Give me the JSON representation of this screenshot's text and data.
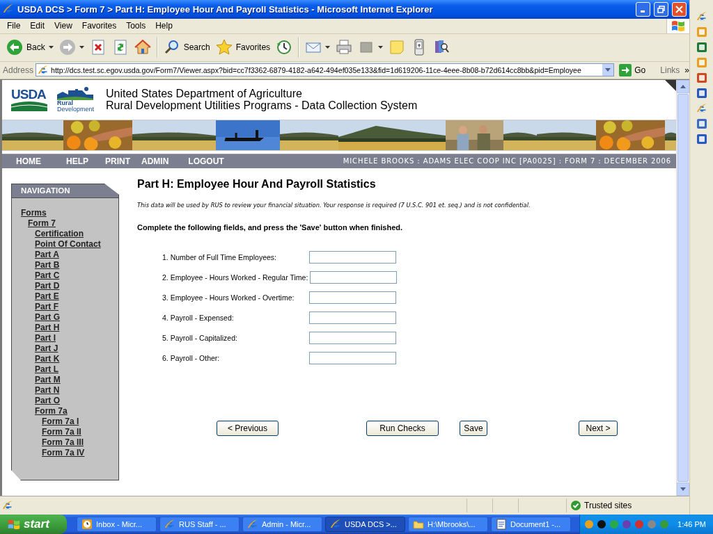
{
  "window": {
    "title": "USDA DCS > Form 7 > Part H: Employee Hour And Payroll Statistics - Microsoft Internet Explorer"
  },
  "menu_bar": [
    "File",
    "Edit",
    "View",
    "Favorites",
    "Tools",
    "Help"
  ],
  "toolbar": [
    {
      "kind": "back",
      "label": "Back",
      "dropdown": true
    },
    {
      "kind": "forward",
      "dropdown": true
    },
    {
      "kind": "stop",
      "dropdown": false
    },
    {
      "kind": "refresh",
      "dropdown": false
    },
    {
      "kind": "home",
      "dropdown": false
    },
    {
      "kind": "separator"
    },
    {
      "kind": "search",
      "label": "Search",
      "dropdown": false
    },
    {
      "kind": "favorites",
      "label": "Favorites",
      "dropdown": false
    },
    {
      "kind": "history",
      "dropdown": false
    },
    {
      "kind": "separator"
    },
    {
      "kind": "mail",
      "dropdown": true
    },
    {
      "kind": "print",
      "dropdown": false
    },
    {
      "kind": "edit",
      "dropdown": true
    },
    {
      "kind": "note",
      "dropdown": false
    },
    {
      "kind": "device",
      "dropdown": false
    },
    {
      "kind": "research",
      "dropdown": false
    }
  ],
  "address_bar": {
    "label": "Address",
    "url": "http://dcs.test.sc.egov.usda.gov/Form7/Viewer.aspx?bid=cc7f3362-6879-4182-a642-494ef035e133&fid=1d619206-11ce-4eee-8b08-b72d614cc8bb&pid=Employee",
    "go": "Go",
    "links": "Links",
    "links_more": "»"
  },
  "page": {
    "logo": {
      "usda": "USDA",
      "rd_line_1": "Rural",
      "rd_line_2": "Development"
    },
    "header_lines": [
      "United States Department of Agriculture",
      "Rural Development Utilities Programs - Data Collection System"
    ],
    "nav_links": [
      "HOME",
      "HELP",
      "PRINT",
      "ADMIN",
      "LOGOUT"
    ],
    "user_info": "MICHELE BROOKS : ADAMS ELEC COOP INC [PA0025] : FORM 7 : DECEMBER 2006",
    "navigation": {
      "title": "NAVIGATION",
      "items": [
        {
          "label": "Forms",
          "children": [
            {
              "label": "Form 7",
              "children": [
                {
                  "label": "Certification"
                },
                {
                  "label": "Point Of Contact"
                },
                {
                  "label": "Part A"
                },
                {
                  "label": "Part B"
                },
                {
                  "label": "Part C"
                },
                {
                  "label": "Part D"
                },
                {
                  "label": "Part E"
                },
                {
                  "label": "Part F"
                },
                {
                  "label": "Part G"
                },
                {
                  "label": "Part H"
                },
                {
                  "label": "Part I"
                },
                {
                  "label": "Part J"
                },
                {
                  "label": "Part K"
                },
                {
                  "label": "Part L"
                },
                {
                  "label": "Part M"
                },
                {
                  "label": "Part N"
                },
                {
                  "label": "Part O"
                },
                {
                  "label": "Form 7a",
                  "children": [
                    {
                      "label": "Form 7a I"
                    },
                    {
                      "label": "Form 7a II"
                    },
                    {
                      "label": "Form 7a III"
                    },
                    {
                      "label": "Form 7a IV"
                    }
                  ]
                }
              ]
            }
          ]
        }
      ]
    },
    "heading": "Part H: Employee Hour And Payroll Statistics",
    "notice": "This data will be used by RUS to review your financial situation. Your response is required (7 U.S.C. 901 et. seq.) and is not confidential.",
    "instruction": "Complete the following fields, and press the 'Save' button when finished.",
    "fields": [
      {
        "label": "1. Number of Full Time Employees:"
      },
      {
        "label": "2. Employee - Hours Worked - Regular Time:"
      },
      {
        "label": "3. Employee - Hours Worked - Overtime:"
      },
      {
        "label": "4. Payroll - Expensed:"
      },
      {
        "label": "5. Payroll - Capitalized:"
      },
      {
        "label": "6. Payroll - Other:"
      }
    ],
    "buttons": [
      "< Previous",
      "Run Checks",
      "Save",
      "Next >"
    ]
  },
  "status_bar": {
    "zone": "Trusted sites"
  },
  "taskbar": {
    "start": "start",
    "tasks": [
      {
        "kind": "clock",
        "label": "Inbox - Micr...",
        "selected": false
      },
      {
        "kind": "browser",
        "label": "RUS Staff - ...",
        "selected": false
      },
      {
        "kind": "browser",
        "label": "Admin - Micr...",
        "selected": false
      },
      {
        "kind": "browser",
        "label": "USDA DCS >...",
        "selected": true
      },
      {
        "kind": "folder",
        "label": "H:\\Mbrooks\\...",
        "selected": false
      },
      {
        "kind": "document",
        "label": "Document1 -...",
        "selected": false
      }
    ],
    "clock": "1:46 PM"
  }
}
